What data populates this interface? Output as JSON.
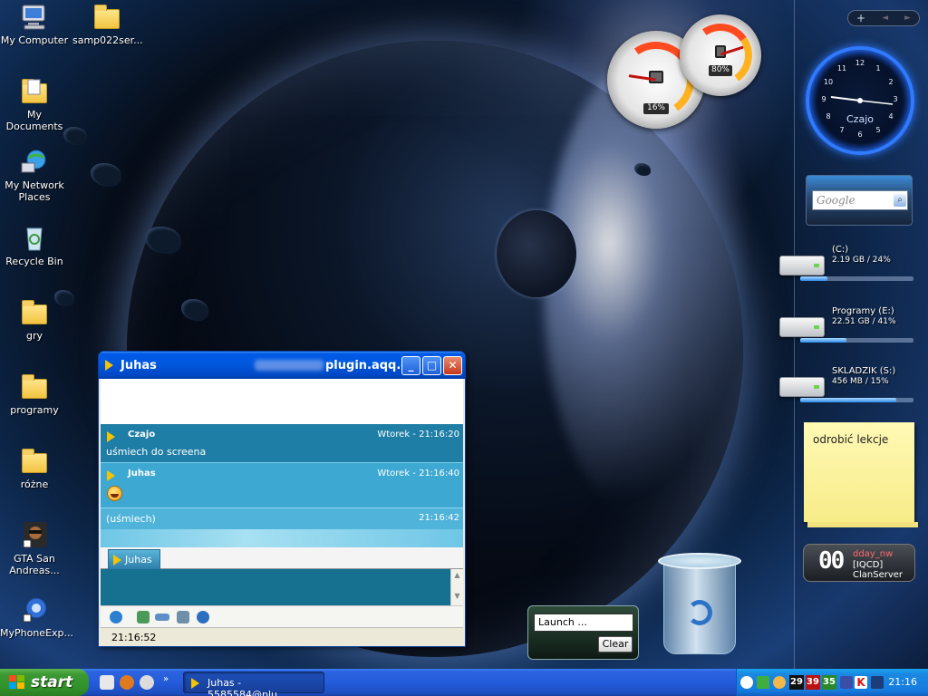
{
  "desktop": {
    "icons": [
      {
        "label": "My Computer"
      },
      {
        "label": "samp022ser..."
      },
      {
        "label": "My Documents"
      },
      {
        "label": "My Network Places"
      },
      {
        "label": "Recycle Bin"
      },
      {
        "label": "gry"
      },
      {
        "label": "programy"
      },
      {
        "label": "różne"
      },
      {
        "label": "GTA San Andreas..."
      },
      {
        "label": "MyPhoneExp..."
      }
    ]
  },
  "gauges": {
    "cpu": {
      "readout": "16%",
      "level": 0.16
    },
    "memory": {
      "readout": "80%",
      "level": 0.8
    }
  },
  "sidebar": {
    "controls": {
      "add": "+",
      "prev": "◄",
      "next": "►"
    },
    "clock": {
      "label": "Czajo",
      "numbers": [
        "12",
        "1",
        "2",
        "3",
        "4",
        "5",
        "6",
        "7",
        "8",
        "9",
        "10",
        "11"
      ]
    },
    "search": {
      "placeholder": "Google"
    },
    "drives": [
      {
        "name": "(C:)",
        "stat": "2.19 GB / 24%",
        "fill": 0.24
      },
      {
        "name": "Programy (E:)",
        "stat": "22.51 GB / 41%",
        "fill": 0.41
      },
      {
        "name": "SKLADZIK (S:)",
        "stat": "456 MB / 15%",
        "fill": 0.85
      }
    ],
    "note": "odrobić lekcje",
    "xfire": {
      "big": "00",
      "line1": "dday_nw",
      "line2": "[IQCD] ClanServer"
    }
  },
  "launcher": {
    "input_value": "Launch ...",
    "clear_label": "Clear"
  },
  "chat_window": {
    "title_prefix": "Juhas",
    "title_suffix": "plugin.aqq.eu",
    "messages": [
      {
        "sender": "Czajo",
        "time": "Wtorek - 21:16:20",
        "text": "uśmiech do screena"
      },
      {
        "sender": "Juhas",
        "time": "Wtorek - 21:16:40",
        "text": ""
      },
      {
        "sender": "",
        "time": "21:16:42",
        "text": "(uśmiech)"
      }
    ],
    "tab_label": "Juhas",
    "status_time": "21:16:52"
  },
  "taskbar": {
    "start_label": "start",
    "task_button": "Juhas - 5585584@plu...",
    "tray_numbers": [
      "29",
      "39",
      "35"
    ],
    "clock": "21:16"
  }
}
